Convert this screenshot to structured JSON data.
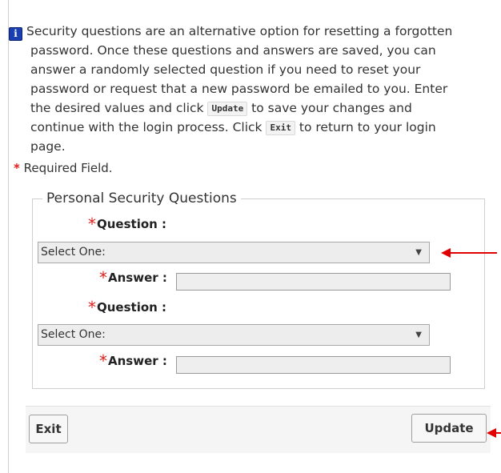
{
  "info": {
    "icon": "info-icon",
    "line1": "Security questions are an alternative option for resetting a forgotten",
    "line2": "password. Once these questions and answers are saved, you can",
    "line3": "answer a randomly selected question if you need to reset your",
    "line4": "password or request that a new password be emailed to you. Enter",
    "line5a": "the desired values and click ",
    "update_kbd": "Update",
    "line5b": " to save your changes and",
    "line6a": "continue with the login process. Click ",
    "exit_kbd": "Exit",
    "line6b": " to return to your login",
    "line7": "page."
  },
  "required_note": {
    "star": "*",
    "text": " Required Field."
  },
  "fieldset": {
    "legend": "Personal Security Questions",
    "rows": [
      {
        "question_star": "*",
        "question_label": "Question :",
        "select_value": "Select One:",
        "answer_star": "*",
        "answer_label": "Answer :",
        "answer_value": ""
      },
      {
        "question_star": "*",
        "question_label": "Question :",
        "select_value": "Select One:",
        "answer_star": "*",
        "answer_label": "Answer :",
        "answer_value": ""
      }
    ]
  },
  "footer": {
    "exit_label": "Exit",
    "update_label": "Update"
  },
  "colors": {
    "required_star": "#e0201b",
    "annotation_arrow": "#e00000",
    "info_icon_bg": "#1a3fb0"
  }
}
